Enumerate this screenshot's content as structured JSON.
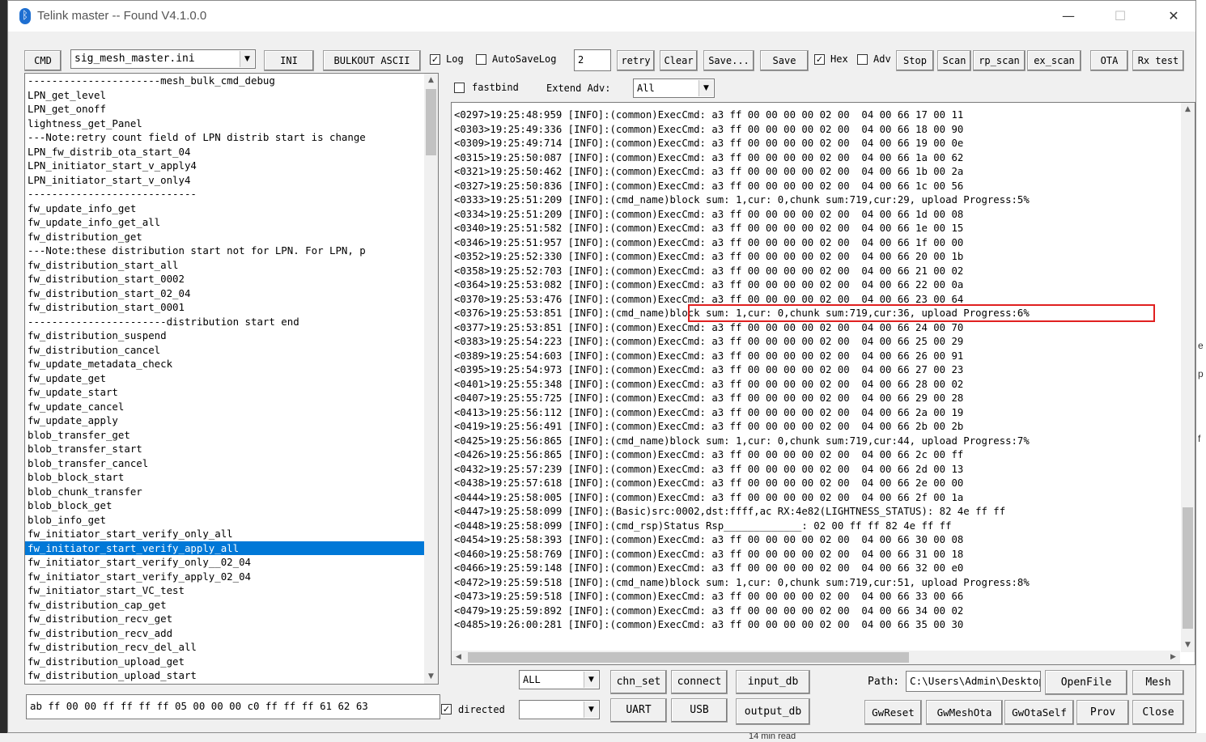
{
  "window": {
    "title": "Telink master -- Found    V4.1.0.0",
    "minimize": "—",
    "maximize": "☐",
    "close": "✕"
  },
  "toolbar": {
    "cmd_label": "CMD",
    "ini_file": "sig_mesh_master.ini",
    "ini_label": "INI",
    "bulkout_label": "BULKOUT ASCII",
    "log_label": "Log",
    "log_checked": true,
    "autosave_label": "AutoSaveLog",
    "autosave_checked": false,
    "retry_value": "2",
    "retry_label": "retry",
    "clear_label": "Clear",
    "saveas_label": "Save...",
    "save_label": "Save",
    "hex_label": "Hex",
    "hex_checked": true,
    "adv_label": "Adv",
    "adv_checked": false,
    "stop_label": "Stop",
    "scan_label": "Scan",
    "rp_scan_label": "rp_scan",
    "ex_scan_label": "ex_scan",
    "ota_label": "OTA",
    "rx_test_label": "Rx test"
  },
  "options": {
    "fastbind_label": "fastbind",
    "fastbind_checked": false,
    "extend_adv_label": "Extend Adv:",
    "extend_adv_value": "All"
  },
  "command_list": {
    "selected_index": 33,
    "items": [
      "----------------------mesh_bulk_cmd_debug",
      "LPN_get_level",
      "LPN_get_onoff",
      "lightness_get_Panel",
      "---Note:retry count field of LPN distrib start is change",
      "LPN_fw_distrib_ota_start_04",
      "LPN_initiator_start_v_apply4",
      "LPN_initiator_start_v_only4",
      "----------------------------",
      "fw_update_info_get",
      "fw_update_info_get_all",
      "fw_distribution_get",
      "---Note:these distribution start not for LPN. For LPN, p",
      "fw_distribution_start_all",
      "fw_distribution_start_0002",
      "fw_distribution_start_02_04",
      "fw_distribution_start_0001",
      "-----------------------distribution start end",
      "fw_distribution_suspend",
      "fw_distribution_cancel",
      "fw_update_metadata_check",
      "fw_update_get",
      "fw_update_start",
      "fw_update_cancel",
      "fw_update_apply",
      "blob_transfer_get",
      "blob_transfer_start",
      "blob_transfer_cancel",
      "blob_block_start",
      "blob_chunk_transfer",
      "blob_block_get",
      "blob_info_get",
      "fw_initiator_start_verify_only_all",
      "fw_initiator_start_verify_apply_all",
      "fw_initiator_start_verify_only__02_04",
      "fw_initiator_start_verify_apply_02_04",
      "fw_initiator_start_VC_test",
      "fw_distribution_cap_get",
      "fw_distribution_recv_get",
      "fw_distribution_recv_add",
      "fw_distribution_recv_del_all",
      "fw_distribution_upload_get",
      "fw_distribution_upload_start"
    ]
  },
  "log": {
    "highlighted_index": 14,
    "lines": [
      "<0297>19:25:48:959 [INFO]:(common)ExecCmd: a3 ff 00 00 00 00 02 00  04 00 66 17 00 11",
      "<0303>19:25:49:336 [INFO]:(common)ExecCmd: a3 ff 00 00 00 00 02 00  04 00 66 18 00 90",
      "<0309>19:25:49:714 [INFO]:(common)ExecCmd: a3 ff 00 00 00 00 02 00  04 00 66 19 00 0e",
      "<0315>19:25:50:087 [INFO]:(common)ExecCmd: a3 ff 00 00 00 00 02 00  04 00 66 1a 00 62",
      "<0321>19:25:50:462 [INFO]:(common)ExecCmd: a3 ff 00 00 00 00 02 00  04 00 66 1b 00 2a",
      "<0327>19:25:50:836 [INFO]:(common)ExecCmd: a3 ff 00 00 00 00 02 00  04 00 66 1c 00 56",
      "<0333>19:25:51:209 [INFO]:(cmd_name)block sum: 1,cur: 0,chunk sum:719,cur:29, upload Progress:5%",
      "<0334>19:25:51:209 [INFO]:(common)ExecCmd: a3 ff 00 00 00 00 02 00  04 00 66 1d 00 08",
      "<0340>19:25:51:582 [INFO]:(common)ExecCmd: a3 ff 00 00 00 00 02 00  04 00 66 1e 00 15",
      "<0346>19:25:51:957 [INFO]:(common)ExecCmd: a3 ff 00 00 00 00 02 00  04 00 66 1f 00 00",
      "<0352>19:25:52:330 [INFO]:(common)ExecCmd: a3 ff 00 00 00 00 02 00  04 00 66 20 00 1b",
      "<0358>19:25:52:703 [INFO]:(common)ExecCmd: a3 ff 00 00 00 00 02 00  04 00 66 21 00 02",
      "<0364>19:25:53:082 [INFO]:(common)ExecCmd: a3 ff 00 00 00 00 02 00  04 00 66 22 00 0a",
      "<0370>19:25:53:476 [INFO]:(common)ExecCmd: a3 ff 00 00 00 00 02 00  04 00 66 23 00 64",
      "<0376>19:25:53:851 [INFO]:(cmd_name)block sum: 1,cur: 0,chunk sum:719,cur:36, upload Progress:6%",
      "<0377>19:25:53:851 [INFO]:(common)ExecCmd: a3 ff 00 00 00 00 02 00  04 00 66 24 00 70",
      "<0383>19:25:54:223 [INFO]:(common)ExecCmd: a3 ff 00 00 00 00 02 00  04 00 66 25 00 29",
      "<0389>19:25:54:603 [INFO]:(common)ExecCmd: a3 ff 00 00 00 00 02 00  04 00 66 26 00 91",
      "<0395>19:25:54:973 [INFO]:(common)ExecCmd: a3 ff 00 00 00 00 02 00  04 00 66 27 00 23",
      "<0401>19:25:55:348 [INFO]:(common)ExecCmd: a3 ff 00 00 00 00 02 00  04 00 66 28 00 02",
      "<0407>19:25:55:725 [INFO]:(common)ExecCmd: a3 ff 00 00 00 00 02 00  04 00 66 29 00 28",
      "<0413>19:25:56:112 [INFO]:(common)ExecCmd: a3 ff 00 00 00 00 02 00  04 00 66 2a 00 19",
      "<0419>19:25:56:491 [INFO]:(common)ExecCmd: a3 ff 00 00 00 00 02 00  04 00 66 2b 00 2b",
      "<0425>19:25:56:865 [INFO]:(cmd_name)block sum: 1,cur: 0,chunk sum:719,cur:44, upload Progress:7%",
      "<0426>19:25:56:865 [INFO]:(common)ExecCmd: a3 ff 00 00 00 00 02 00  04 00 66 2c 00 ff",
      "<0432>19:25:57:239 [INFO]:(common)ExecCmd: a3 ff 00 00 00 00 02 00  04 00 66 2d 00 13",
      "<0438>19:25:57:618 [INFO]:(common)ExecCmd: a3 ff 00 00 00 00 02 00  04 00 66 2e 00 00",
      "<0444>19:25:58:005 [INFO]:(common)ExecCmd: a3 ff 00 00 00 00 02 00  04 00 66 2f 00 1a",
      "<0447>19:25:58:099 [INFO]:(Basic)src:0002,dst:ffff,ac RX:4e82(LIGHTNESS_STATUS): 82 4e ff ff",
      "<0448>19:25:58:099 [INFO]:(cmd_rsp)Status Rsp_____________: 02 00 ff ff 82 4e ff ff",
      "<0454>19:25:58:393 [INFO]:(common)ExecCmd: a3 ff 00 00 00 00 02 00  04 00 66 30 00 08",
      "<0460>19:25:58:769 [INFO]:(common)ExecCmd: a3 ff 00 00 00 00 02 00  04 00 66 31 00 18",
      "<0466>19:25:59:148 [INFO]:(common)ExecCmd: a3 ff 00 00 00 00 02 00  04 00 66 32 00 e0",
      "<0472>19:25:59:518 [INFO]:(cmd_name)block sum: 1,cur: 0,chunk sum:719,cur:51, upload Progress:8%",
      "<0473>19:25:59:518 [INFO]:(common)ExecCmd: a3 ff 00 00 00 00 02 00  04 00 66 33 00 66",
      "<0479>19:25:59:892 [INFO]:(common)ExecCmd: a3 ff 00 00 00 00 02 00  04 00 66 34 00 02",
      "<0485>19:26:00:281 [INFO]:(common)ExecCmd: a3 ff 00 00 00 00 02 00  04 00 66 35 00 30"
    ]
  },
  "bottom": {
    "command_input": "ab ff 00 00 ff ff ff ff 05 00 00 00 c0 ff ff ff 61 62 63",
    "directed_label": "directed",
    "directed_checked": true,
    "all_select": "ALL",
    "second_select": "",
    "chn_set": "chn_set",
    "connect": "connect",
    "input_db": "input_db",
    "uart": "UART",
    "usb": "USB",
    "output_db": "output_db",
    "path_label": "Path:",
    "path_value": "C:\\Users\\Admin\\Desktop",
    "openfile": "OpenFile",
    "mesh": "Mesh",
    "gwreset": "GwReset",
    "gwmeshota": "GwMeshOta",
    "gwotaself": "GwOtaSelf",
    "prov": "Prov",
    "close": "Close"
  },
  "background": {
    "side_chars": [
      "e",
      "p",
      "f"
    ],
    "bottom_text": "14 min read"
  },
  "colors": {
    "selection": "#0078d7",
    "highlight_box": "#e02020",
    "bluetooth": "#1e6fd1"
  },
  "icons": {
    "app": "bluetooth-icon",
    "dropdown": "chevron-down-icon",
    "check": "checkmark-icon"
  }
}
